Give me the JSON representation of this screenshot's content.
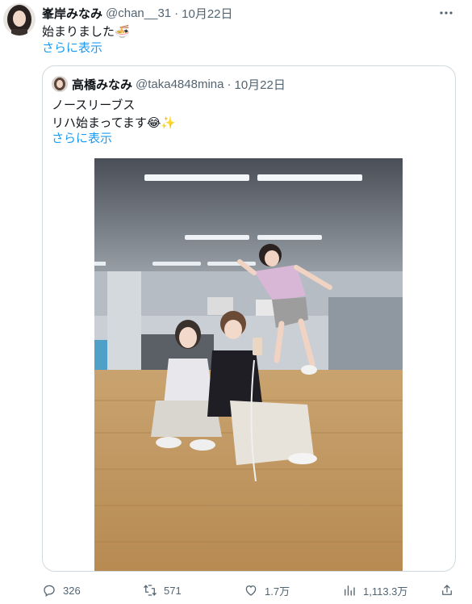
{
  "tweet": {
    "author_name": "峯岸みなみ",
    "handle": "@chan__31",
    "separator": "·",
    "date": "10月22日",
    "text": "始まりました",
    "text_emoji": "🍜",
    "show_more": "さらに表示"
  },
  "quote": {
    "author_name": "高橋みなみ",
    "handle": "@taka4848mina",
    "separator": "·",
    "date": "10月22日",
    "line1": "ノースリーブス",
    "line2": "リハ始まってます",
    "line2_emoji": "😂✨",
    "show_more": "さらに表示"
  },
  "actions": {
    "replies": "326",
    "retweets": "571",
    "likes": "1.7万",
    "views": "1,113.3万"
  },
  "icons": [
    "more-icon",
    "reply-icon",
    "retweet-icon",
    "like-icon",
    "views-icon",
    "share-icon"
  ],
  "colors": {
    "link": "#1d9bf0",
    "secondary": "#536471",
    "border": "#cfd9de"
  }
}
